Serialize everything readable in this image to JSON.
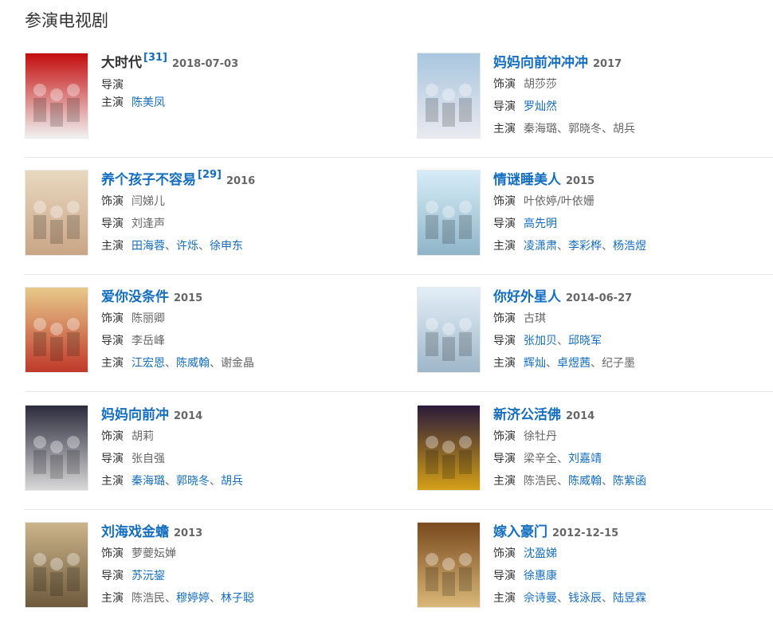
{
  "section_title": "参演电视剧",
  "labels": {
    "role": "饰演",
    "director": "导演",
    "cast": "主演",
    "sep": "、"
  },
  "colors": {
    "link": "#136ec2",
    "text": "#333333",
    "muted": "#666666",
    "divider": "#e6e6e6"
  },
  "items": [
    {
      "title": "大时代",
      "ref": "[31]",
      "date": "2018-07-03",
      "title_is_link": false,
      "role": null,
      "director": "",
      "cast": [
        {
          "name": "陈美凤",
          "link": true
        }
      ],
      "poster": {
        "caption": "大时代",
        "palette": [
          "#c40d0d",
          "#f1f1f1"
        ]
      }
    },
    {
      "title": "妈妈向前冲冲冲",
      "ref": "",
      "date": "2017",
      "title_is_link": true,
      "role": {
        "name": "胡莎莎",
        "link": false
      },
      "director": [
        {
          "name": "罗灿然",
          "link": true
        }
      ],
      "cast": [
        {
          "name": "秦海璐",
          "link": false
        },
        {
          "name": "郭晓冬",
          "link": false
        },
        {
          "name": "胡兵",
          "link": false
        }
      ],
      "poster": {
        "caption": "",
        "palette": [
          "#a9c6de",
          "#e9e9f0"
        ]
      }
    },
    {
      "title": "养个孩子不容易",
      "ref": "[29]",
      "date": "2016",
      "title_is_link": true,
      "role": {
        "name": "闫娣儿",
        "link": false
      },
      "director": [
        {
          "name": "刘逢声",
          "link": false
        }
      ],
      "cast": [
        {
          "name": "田海蓉",
          "link": true
        },
        {
          "name": "许烁",
          "link": true
        },
        {
          "name": "徐申东",
          "link": true
        }
      ],
      "poster": {
        "caption": "养",
        "palette": [
          "#e8d8c0",
          "#c9a585"
        ]
      }
    },
    {
      "title": "情谜睡美人",
      "ref": "",
      "date": "2015",
      "title_is_link": true,
      "role": {
        "name": "叶依婷/叶依姗",
        "link": false
      },
      "director": [
        {
          "name": "高先明",
          "link": true
        }
      ],
      "cast": [
        {
          "name": "凌潇肃",
          "link": true
        },
        {
          "name": "李彩桦",
          "link": true
        },
        {
          "name": "杨浩煜",
          "link": true
        }
      ],
      "poster": {
        "caption": "情谜睡美人",
        "palette": [
          "#d6ecf7",
          "#8fb5c9"
        ]
      }
    },
    {
      "title": "爱你没条件",
      "ref": "",
      "date": "2015",
      "title_is_link": true,
      "role": {
        "name": "陈丽卿",
        "link": false
      },
      "director": [
        {
          "name": "李岳峰",
          "link": false
        }
      ],
      "cast": [
        {
          "name": "江宏恩",
          "link": true
        },
        {
          "name": "陈威翰",
          "link": true
        },
        {
          "name": "谢金晶",
          "link": false
        }
      ],
      "poster": {
        "caption": "爱你没条件",
        "palette": [
          "#e7c98a",
          "#c0392b"
        ]
      }
    },
    {
      "title": "你好外星人",
      "ref": "",
      "date": "2014-06-27",
      "title_is_link": true,
      "role": {
        "name": "古琪",
        "link": false
      },
      "director": [
        {
          "name": "张加贝",
          "link": true
        },
        {
          "name": "邱晓军",
          "link": true
        }
      ],
      "cast": [
        {
          "name": "辉灿",
          "link": true
        },
        {
          "name": "卓煜茜",
          "link": true
        },
        {
          "name": "纪子墨",
          "link": false
        }
      ],
      "poster": {
        "caption": "你好外星人",
        "palette": [
          "#e3eef7",
          "#9fb7c9"
        ]
      }
    },
    {
      "title": "妈妈向前冲",
      "ref": "",
      "date": "2014",
      "title_is_link": true,
      "role": {
        "name": "胡莉",
        "link": false
      },
      "director": [
        {
          "name": "张自强",
          "link": false
        }
      ],
      "cast": [
        {
          "name": "秦海璐",
          "link": true
        },
        {
          "name": "郭晓冬",
          "link": true
        },
        {
          "name": "胡兵",
          "link": true
        }
      ],
      "poster": {
        "caption": "妈妈向前冲",
        "palette": [
          "#2b2b3c",
          "#d9d9d9"
        ]
      }
    },
    {
      "title": "新济公活佛",
      "ref": "",
      "date": "2014",
      "title_is_link": true,
      "role": {
        "name": "徐牡丹",
        "link": false
      },
      "director": [
        {
          "name": "梁辛全",
          "link": false
        },
        {
          "name": "刘嘉靖",
          "link": true
        }
      ],
      "cast": [
        {
          "name": "陈浩民",
          "link": false
        },
        {
          "name": "陈威翰",
          "link": true
        },
        {
          "name": "陈紫函",
          "link": true
        }
      ],
      "poster": {
        "caption": "新济公活佛",
        "palette": [
          "#2a1a3a",
          "#d4a017"
        ]
      }
    },
    {
      "title": "刘海戏金蟾",
      "ref": "",
      "date": "2013",
      "title_is_link": true,
      "role": {
        "name": "萝夔妘婵",
        "link": false
      },
      "director": [
        {
          "name": "苏沅鋆",
          "link": true
        }
      ],
      "cast": [
        {
          "name": "陈浩民",
          "link": false
        },
        {
          "name": "穆婷婷",
          "link": true
        },
        {
          "name": "林子聪",
          "link": true
        }
      ],
      "poster": {
        "caption": "",
        "palette": [
          "#cbb48a",
          "#6e5a3c"
        ]
      }
    },
    {
      "title": "嫁入豪门",
      "ref": "",
      "date": "2012-12-15",
      "title_is_link": true,
      "role": {
        "name": "沈盈娣",
        "link": true
      },
      "director": [
        {
          "name": "徐惠康",
          "link": true
        }
      ],
      "cast": [
        {
          "name": "佘诗曼",
          "link": true
        },
        {
          "name": "钱泳辰",
          "link": true
        },
        {
          "name": "陆昱霖",
          "link": true
        }
      ],
      "poster": {
        "caption": "嫁入豪门",
        "palette": [
          "#7a4a1e",
          "#d9b778"
        ]
      }
    }
  ]
}
